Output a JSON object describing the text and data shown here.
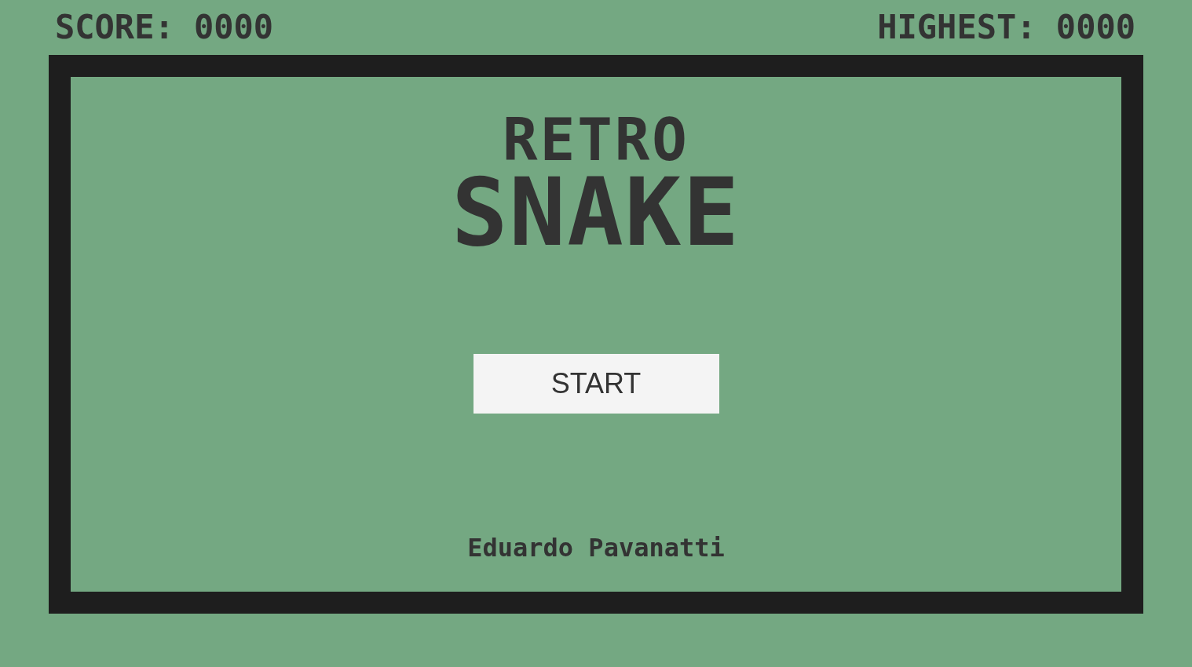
{
  "header": {
    "score": "SCORE: 0000",
    "highest": "HIGHEST: 0000"
  },
  "title": {
    "line_1": "RETRO",
    "line_2": "SNAKE"
  },
  "start_button": {
    "label": "START"
  },
  "credit": "Eduardo Pavanatti"
}
